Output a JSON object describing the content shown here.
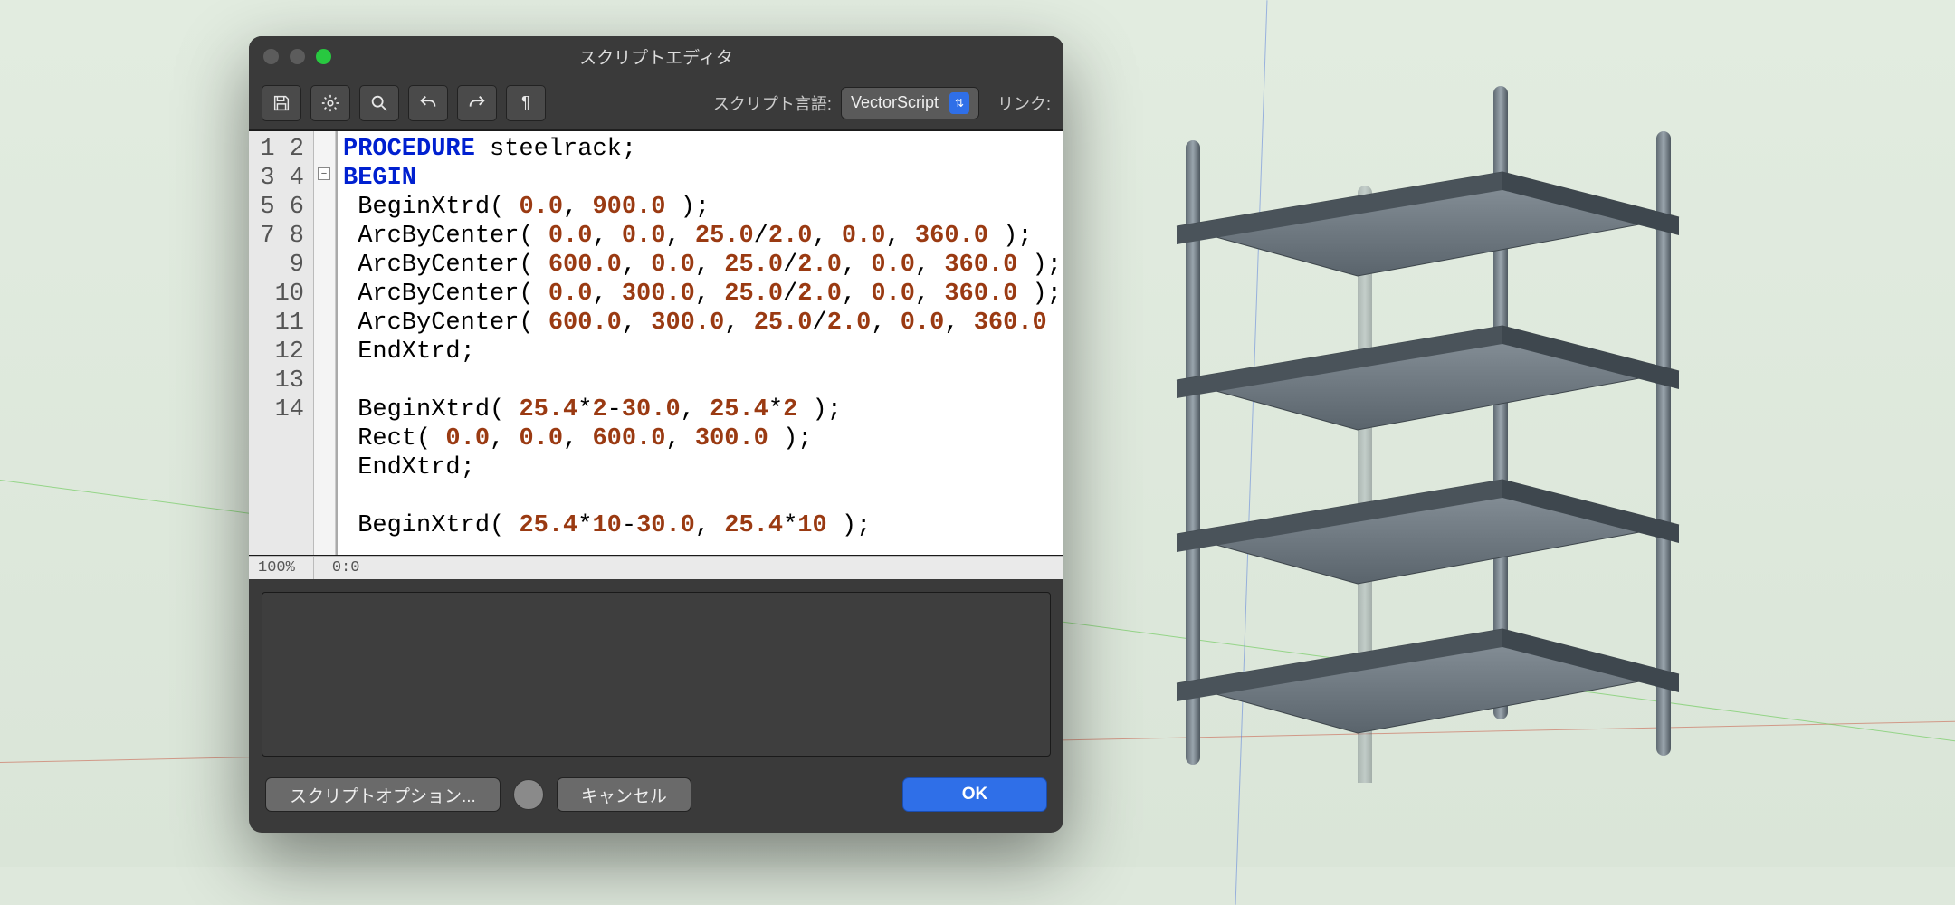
{
  "window": {
    "title": "スクリプトエディタ"
  },
  "toolbar": {
    "script_lang_label": "スクリプト言語:",
    "script_lang_value": "VectorScript",
    "link_label": "リンク:"
  },
  "editor": {
    "lines": [
      [
        {
          "t": "kw",
          "v": "PROCEDURE"
        },
        {
          "t": "tx",
          "v": " steelrack;"
        }
      ],
      [
        {
          "t": "kw",
          "v": "BEGIN"
        }
      ],
      [
        {
          "t": "tx",
          "v": "BeginXtrd( "
        },
        {
          "t": "num",
          "v": "0.0"
        },
        {
          "t": "tx",
          "v": ", "
        },
        {
          "t": "num",
          "v": "900.0"
        },
        {
          "t": "tx",
          "v": " );"
        }
      ],
      [
        {
          "t": "tx",
          "v": "ArcByCenter( "
        },
        {
          "t": "num",
          "v": "0.0"
        },
        {
          "t": "tx",
          "v": ", "
        },
        {
          "t": "num",
          "v": "0.0"
        },
        {
          "t": "tx",
          "v": ", "
        },
        {
          "t": "num",
          "v": "25.0"
        },
        {
          "t": "tx",
          "v": "/"
        },
        {
          "t": "num",
          "v": "2.0"
        },
        {
          "t": "tx",
          "v": ", "
        },
        {
          "t": "num",
          "v": "0.0"
        },
        {
          "t": "tx",
          "v": ", "
        },
        {
          "t": "num",
          "v": "360.0"
        },
        {
          "t": "tx",
          "v": " );"
        }
      ],
      [
        {
          "t": "tx",
          "v": "ArcByCenter( "
        },
        {
          "t": "num",
          "v": "600.0"
        },
        {
          "t": "tx",
          "v": ", "
        },
        {
          "t": "num",
          "v": "0.0"
        },
        {
          "t": "tx",
          "v": ", "
        },
        {
          "t": "num",
          "v": "25.0"
        },
        {
          "t": "tx",
          "v": "/"
        },
        {
          "t": "num",
          "v": "2.0"
        },
        {
          "t": "tx",
          "v": ", "
        },
        {
          "t": "num",
          "v": "0.0"
        },
        {
          "t": "tx",
          "v": ", "
        },
        {
          "t": "num",
          "v": "360.0"
        },
        {
          "t": "tx",
          "v": " );"
        }
      ],
      [
        {
          "t": "tx",
          "v": "ArcByCenter( "
        },
        {
          "t": "num",
          "v": "0.0"
        },
        {
          "t": "tx",
          "v": ", "
        },
        {
          "t": "num",
          "v": "300.0"
        },
        {
          "t": "tx",
          "v": ", "
        },
        {
          "t": "num",
          "v": "25.0"
        },
        {
          "t": "tx",
          "v": "/"
        },
        {
          "t": "num",
          "v": "2.0"
        },
        {
          "t": "tx",
          "v": ", "
        },
        {
          "t": "num",
          "v": "0.0"
        },
        {
          "t": "tx",
          "v": ", "
        },
        {
          "t": "num",
          "v": "360.0"
        },
        {
          "t": "tx",
          "v": " );"
        }
      ],
      [
        {
          "t": "tx",
          "v": "ArcByCenter( "
        },
        {
          "t": "num",
          "v": "600.0"
        },
        {
          "t": "tx",
          "v": ", "
        },
        {
          "t": "num",
          "v": "300.0"
        },
        {
          "t": "tx",
          "v": ", "
        },
        {
          "t": "num",
          "v": "25.0"
        },
        {
          "t": "tx",
          "v": "/"
        },
        {
          "t": "num",
          "v": "2.0"
        },
        {
          "t": "tx",
          "v": ", "
        },
        {
          "t": "num",
          "v": "0.0"
        },
        {
          "t": "tx",
          "v": ", "
        },
        {
          "t": "num",
          "v": "360.0"
        }
      ],
      [
        {
          "t": "tx",
          "v": "EndXtrd;"
        }
      ],
      [
        {
          "t": "tx",
          "v": ""
        }
      ],
      [
        {
          "t": "tx",
          "v": "BeginXtrd( "
        },
        {
          "t": "num",
          "v": "25.4"
        },
        {
          "t": "tx",
          "v": "*"
        },
        {
          "t": "num",
          "v": "2"
        },
        {
          "t": "tx",
          "v": "-"
        },
        {
          "t": "num",
          "v": "30.0"
        },
        {
          "t": "tx",
          "v": ", "
        },
        {
          "t": "num",
          "v": "25.4"
        },
        {
          "t": "tx",
          "v": "*"
        },
        {
          "t": "num",
          "v": "2"
        },
        {
          "t": "tx",
          "v": " );"
        }
      ],
      [
        {
          "t": "tx",
          "v": "Rect( "
        },
        {
          "t": "num",
          "v": "0.0"
        },
        {
          "t": "tx",
          "v": ", "
        },
        {
          "t": "num",
          "v": "0.0"
        },
        {
          "t": "tx",
          "v": ", "
        },
        {
          "t": "num",
          "v": "600.0"
        },
        {
          "t": "tx",
          "v": ", "
        },
        {
          "t": "num",
          "v": "300.0"
        },
        {
          "t": "tx",
          "v": " );"
        }
      ],
      [
        {
          "t": "tx",
          "v": "EndXtrd;"
        }
      ],
      [
        {
          "t": "tx",
          "v": ""
        }
      ],
      [
        {
          "t": "tx",
          "v": "BeginXtrd( "
        },
        {
          "t": "num",
          "v": "25.4"
        },
        {
          "t": "tx",
          "v": "*"
        },
        {
          "t": "num",
          "v": "10"
        },
        {
          "t": "tx",
          "v": "-"
        },
        {
          "t": "num",
          "v": "30.0"
        },
        {
          "t": "tx",
          "v": ", "
        },
        {
          "t": "num",
          "v": "25.4"
        },
        {
          "t": "tx",
          "v": "*"
        },
        {
          "t": "num",
          "v": "10"
        },
        {
          "t": "tx",
          "v": " );"
        }
      ]
    ],
    "line_numbers": [
      "1",
      "2",
      "3",
      "4",
      "5",
      "6",
      "7",
      "8",
      "9",
      "10",
      "11",
      "12",
      "13",
      "14"
    ],
    "zoom": "100%",
    "cursor": "0:0"
  },
  "buttons": {
    "options": "スクリプトオプション...",
    "cancel": "キャンセル",
    "ok": "OK"
  }
}
